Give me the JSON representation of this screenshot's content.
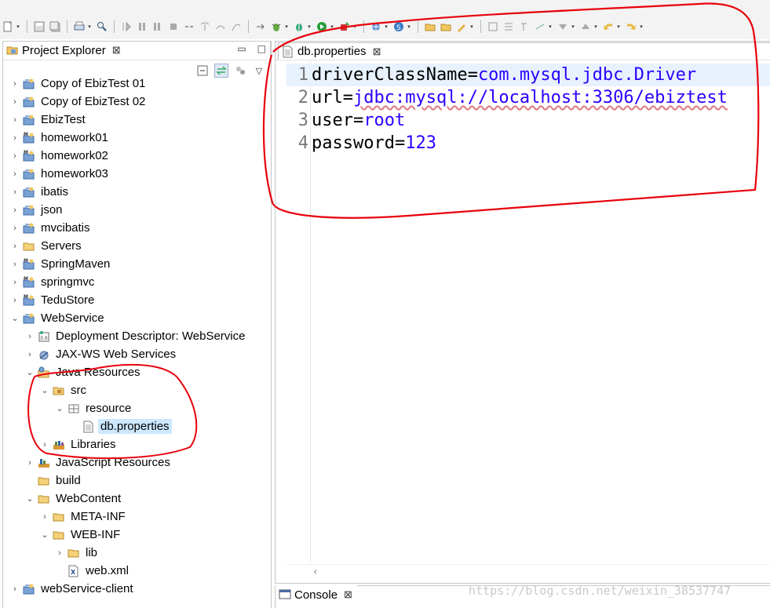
{
  "toolbar": {
    "icons": [
      "new-icon",
      "save-icon",
      "save-all-icon",
      "print-icon",
      "search-icon",
      "debug-icon",
      "run-icon",
      "external-tools-icon",
      "new-server-icon",
      "open-type-icon",
      "open-task-icon",
      "next-annotation-icon",
      "prev-annotation-icon",
      "back-icon",
      "forward-icon"
    ]
  },
  "project_explorer": {
    "title": "Project Explorer",
    "close_glyph": "⊠",
    "minimize_glyph": "▭",
    "maximize_glyph": "□",
    "view_menu_glyph": "▽",
    "items": [
      {
        "label": "Copy of EbizTest 01",
        "depth": 0,
        "expanded": false,
        "icon": "java-project"
      },
      {
        "label": "Copy of EbizTest 02",
        "depth": 0,
        "expanded": false,
        "icon": "java-project"
      },
      {
        "label": "EbizTest",
        "depth": 0,
        "expanded": false,
        "icon": "java-project"
      },
      {
        "label": "homework01",
        "depth": 0,
        "expanded": false,
        "icon": "maven-project"
      },
      {
        "label": "homework02",
        "depth": 0,
        "expanded": false,
        "icon": "maven-project"
      },
      {
        "label": "homework03",
        "depth": 0,
        "expanded": false,
        "icon": "java-project"
      },
      {
        "label": "ibatis",
        "depth": 0,
        "expanded": false,
        "icon": "java-project"
      },
      {
        "label": "json",
        "depth": 0,
        "expanded": false,
        "icon": "java-project"
      },
      {
        "label": "mvcibatis",
        "depth": 0,
        "expanded": false,
        "icon": "java-project"
      },
      {
        "label": "Servers",
        "depth": 0,
        "expanded": false,
        "icon": "folder"
      },
      {
        "label": "SpringMaven",
        "depth": 0,
        "expanded": false,
        "icon": "maven-project"
      },
      {
        "label": "springmvc",
        "depth": 0,
        "expanded": false,
        "icon": "maven-project"
      },
      {
        "label": "TeduStore",
        "depth": 0,
        "expanded": false,
        "icon": "maven-project"
      },
      {
        "label": "WebService",
        "depth": 0,
        "expanded": true,
        "icon": "java-project"
      },
      {
        "label": "Deployment Descriptor: WebService",
        "depth": 1,
        "expanded": false,
        "icon": "deployment-descriptor"
      },
      {
        "label": "JAX-WS Web Services",
        "depth": 1,
        "expanded": false,
        "icon": "web-services"
      },
      {
        "label": "Java Resources",
        "depth": 1,
        "expanded": true,
        "icon": "java-resources"
      },
      {
        "label": "src",
        "depth": 2,
        "expanded": true,
        "icon": "source-folder"
      },
      {
        "label": "resource",
        "depth": 3,
        "expanded": true,
        "icon": "package"
      },
      {
        "label": "db.properties",
        "depth": 4,
        "expanded": null,
        "icon": "file",
        "selected": true
      },
      {
        "label": "Libraries",
        "depth": 2,
        "expanded": false,
        "icon": "libraries"
      },
      {
        "label": "JavaScript Resources",
        "depth": 1,
        "expanded": false,
        "icon": "js-resources"
      },
      {
        "label": "build",
        "depth": 1,
        "expanded": null,
        "icon": "folder"
      },
      {
        "label": "WebContent",
        "depth": 1,
        "expanded": true,
        "icon": "folder"
      },
      {
        "label": "META-INF",
        "depth": 2,
        "expanded": false,
        "icon": "folder"
      },
      {
        "label": "WEB-INF",
        "depth": 2,
        "expanded": true,
        "icon": "folder"
      },
      {
        "label": "lib",
        "depth": 3,
        "expanded": false,
        "icon": "folder"
      },
      {
        "label": "web.xml",
        "depth": 3,
        "expanded": null,
        "icon": "xml-file"
      },
      {
        "label": "webService-client",
        "depth": 0,
        "expanded": false,
        "icon": "java-project"
      }
    ]
  },
  "editor": {
    "tab_title": "db.properties",
    "close_glyph": "⊠",
    "lines": [
      {
        "num": "1",
        "key": "driverClassName",
        "eq": "=",
        "value": "com.mysql.jdbc.Driver",
        "squiggle": false,
        "current": true
      },
      {
        "num": "2",
        "key": "url",
        "eq": "=",
        "value": "jdbc:mysql://localhost:3306/ebiztest",
        "squiggle": true,
        "current": false
      },
      {
        "num": "3",
        "key": "user",
        "eq": "=",
        "value": "root",
        "squiggle": false,
        "current": false
      },
      {
        "num": "4",
        "key": "password",
        "eq": "=",
        "value": "123",
        "squiggle": false,
        "current": false
      }
    ],
    "scroll_left_glyph": "‹"
  },
  "console": {
    "tab_title": "Console",
    "close_glyph": "⊠"
  },
  "watermark": "https://blog.csdn.net/weixin_38537747",
  "colors": {
    "annotation": "#e8000b",
    "value_text": "#2a00ff",
    "selection": "#cce8ff",
    "current_line": "#e8f2fe"
  }
}
